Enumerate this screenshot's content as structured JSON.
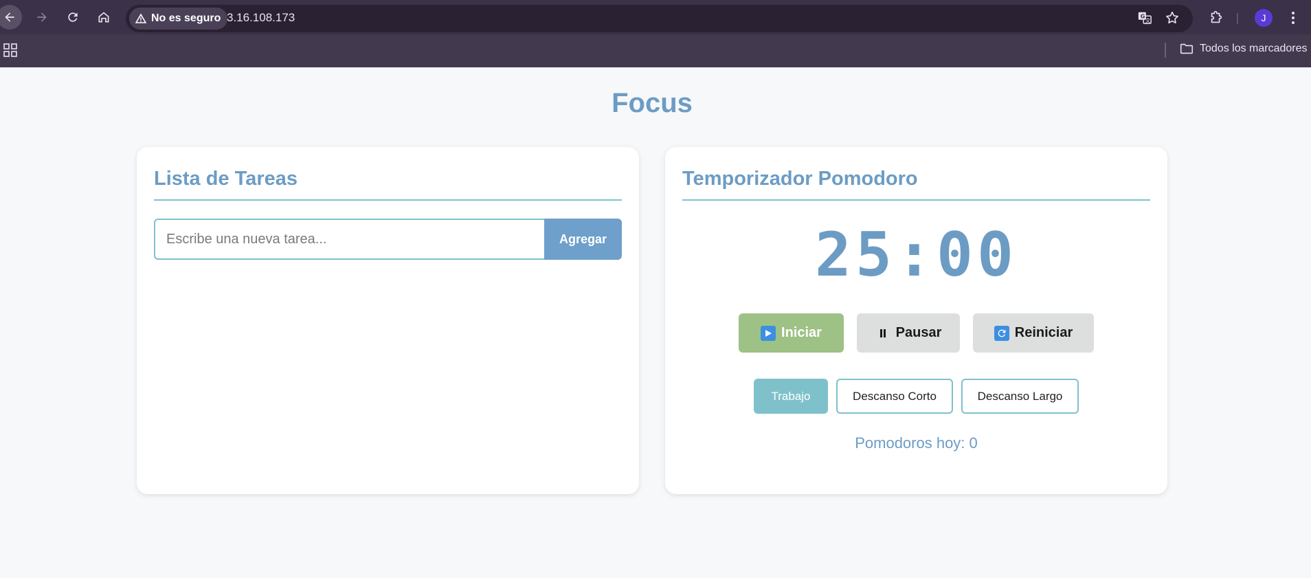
{
  "browser": {
    "security_label": "No es seguro",
    "url": "3.16.108.173",
    "bookmarks_folder_label": "Todos los marcadores",
    "profile_initial": "J",
    "icons": {
      "back": "back-arrow-icon",
      "forward": "forward-arrow-icon",
      "reload": "reload-icon",
      "home": "home-icon",
      "warning": "warning-triangle-icon",
      "translate": "translate-icon",
      "bookmark": "star-icon",
      "extensions": "puzzle-piece-icon",
      "menu": "kebab-menu-icon",
      "apps": "apps-grid-icon",
      "folder": "folder-icon"
    }
  },
  "page": {
    "title": "Focus"
  },
  "tasks": {
    "heading": "Lista de Tareas",
    "input_value": "",
    "input_placeholder": "Escribe una nueva tarea...",
    "add_label": "Agregar",
    "items": []
  },
  "pomodoro": {
    "heading": "Temporizador Pomodoro",
    "time": "25:00",
    "controls": {
      "start_label": "Iniciar",
      "pause_label": "Pausar",
      "reset_label": "Reiniciar"
    },
    "modes": {
      "work_label": "Trabajo",
      "short_break_label": "Descanso Corto",
      "long_break_label": "Descanso Largo",
      "selected": "Trabajo"
    },
    "counter_label": "Pomodoros hoy: 0"
  },
  "colors": {
    "accent_blue": "#6c9cc4",
    "accent_teal": "#7fc1cb",
    "start_green": "#9ec186",
    "neutral_button": "#dcdfde",
    "browser_chrome": "#3b3148"
  }
}
